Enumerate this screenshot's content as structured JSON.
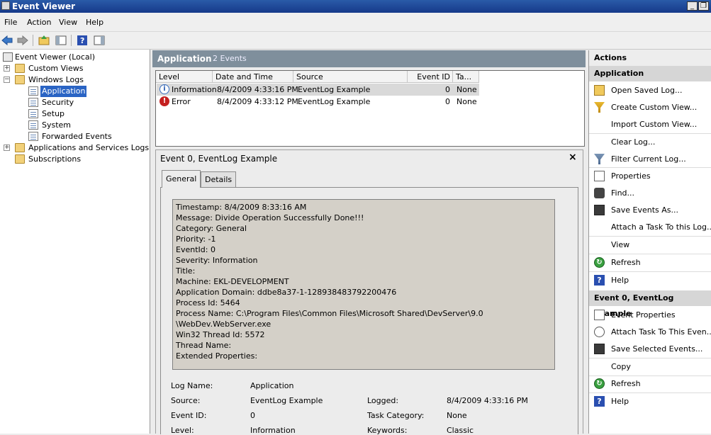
{
  "window": {
    "title": "Event Viewer"
  },
  "menu": [
    "File",
    "Action",
    "View",
    "Help"
  ],
  "tree": {
    "root": "Event Viewer (Local)",
    "custom_views": "Custom Views",
    "windows_logs": "Windows Logs",
    "logs": [
      "Application",
      "Security",
      "Setup",
      "System",
      "Forwarded Events"
    ],
    "apps_services": "Applications and Services Logs",
    "subscriptions": "Subscriptions"
  },
  "center": {
    "title": "Application",
    "count": "2 Events",
    "columns": [
      "Level",
      "Date and Time",
      "Source",
      "Event ID",
      "Ta..."
    ],
    "events": [
      {
        "level": "Information",
        "datetime": "8/4/2009 4:33:16 PM",
        "source": "EventLog Example",
        "event_id": "0",
        "task": "None"
      },
      {
        "level": "Error",
        "datetime": "8/4/2009 4:33:12 PM",
        "source": "EventLog Example",
        "event_id": "0",
        "task": "None"
      }
    ]
  },
  "detail": {
    "title": "Event 0, EventLog Example",
    "close": "×",
    "tabs": [
      "General",
      "Details"
    ],
    "message_lines": [
      "Timestamp: 8/4/2009 8:33:16 AM",
      "Message: Divide Operation Successfully Done!!!",
      "Category: General",
      "Priority: -1",
      "EventId: 0",
      "Severity: Information",
      "Title:",
      "Machine: EKL-DEVELOPMENT",
      "Application Domain: ddbe8a37-1-128938483792200476",
      "Process Id: 5464",
      "Process Name: C:\\Program Files\\Common Files\\Microsoft Shared\\DevServer\\9.0",
      "\\WebDev.WebServer.exe",
      "Win32 Thread Id: 5572",
      "Thread Name:",
      "Extended Properties:"
    ],
    "props": {
      "log_name_label": "Log Name:",
      "log_name": "Application",
      "source_label": "Source:",
      "source": "EventLog Example",
      "logged_label": "Logged:",
      "logged": "8/4/2009 4:33:16 PM",
      "event_id_label": "Event ID:",
      "event_id": "0",
      "task_category_label": "Task Category:",
      "task_category": "None",
      "level_label": "Level:",
      "level": "Information",
      "keywords_label": "Keywords:",
      "keywords": "Classic"
    }
  },
  "actions": {
    "header": "Actions",
    "section1": "Application",
    "section1_items": [
      "Open Saved Log...",
      "Create Custom View...",
      "Import Custom View...",
      "Clear Log...",
      "Filter Current Log...",
      "Properties",
      "Find...",
      "Save Events As...",
      "Attach a Task To this Log...",
      "View",
      "Refresh",
      "Help"
    ],
    "section2": "Event 0, EventLog Example",
    "section2_items": [
      "Event Properties",
      "Attach Task To This Even...",
      "Save Selected Events...",
      "Copy",
      "Refresh",
      "Help"
    ]
  }
}
